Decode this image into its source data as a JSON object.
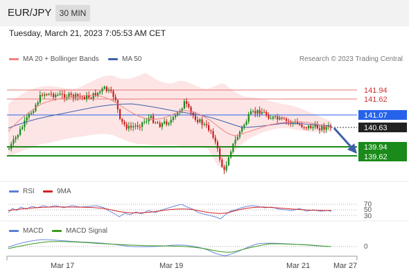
{
  "header": {
    "symbol": "EUR/JPY",
    "timeframe": "30 MIN"
  },
  "timestamp": "Tuesday, March 21, 2023 7:05:53 AM CET",
  "legend": {
    "ma20_label": "MA 20 + Bollinger Bands",
    "ma50_label": "MA 50",
    "credit": "Research © 2023 Trading Central",
    "rsi_label": "RSI",
    "rsi_ma_label": "9MA",
    "macd_label": "MACD",
    "macd_signal_label": "MACD Signal"
  },
  "colors": {
    "candle_up": "#1a8a1a",
    "candle_down": "#c81e1e",
    "ma20": "#f08080",
    "ma50": "#3d5fa8",
    "bollinger_fill": "#fde0e0",
    "resistance": "#e05050",
    "support": "#1a8a1a",
    "pivot": "#2563eb",
    "price_tag": "#222222"
  },
  "chart_data": {
    "type": "candlestick",
    "x_ticks": [
      "Mar 17",
      "Mar 19",
      "Mar 21",
      "Mar 27"
    ],
    "y_range": [
      139.25,
      142.55
    ],
    "levels": {
      "resistance": [
        "141.94",
        "141.62"
      ],
      "pivot": "141.07",
      "current": "140.63",
      "support": [
        "139.94",
        "139.62"
      ]
    },
    "rsi_levels": [
      "70",
      "50",
      "30"
    ],
    "macd_zero": "0"
  }
}
